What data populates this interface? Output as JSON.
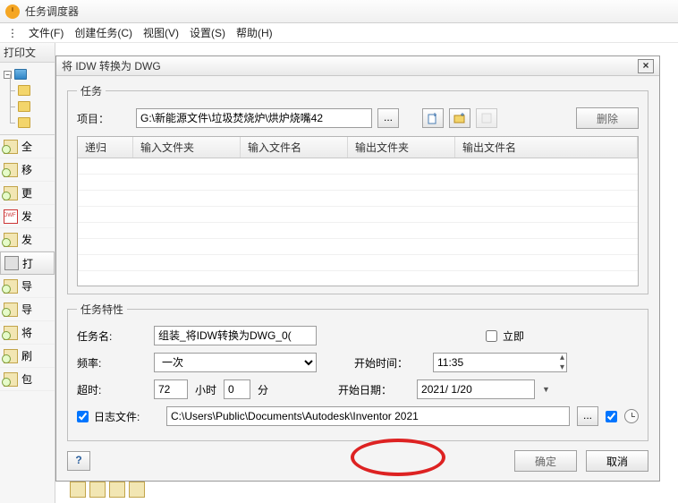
{
  "window": {
    "title": "任务调度器"
  },
  "menu": {
    "file": "文件(F)",
    "create": "创建任务(C)",
    "view": "视图(V)",
    "settings": "设置(S)",
    "help": "帮助(H)"
  },
  "left": {
    "tab": "打印文",
    "sidebar": [
      {
        "label": "全"
      },
      {
        "label": "移"
      },
      {
        "label": "更"
      },
      {
        "label": "发"
      },
      {
        "label": "发"
      },
      {
        "label": "打"
      },
      {
        "label": "导"
      },
      {
        "label": "导"
      },
      {
        "label": "将"
      },
      {
        "label": "刷"
      },
      {
        "label": "包"
      }
    ]
  },
  "dialog": {
    "title": "将 IDW 转换为 DWG",
    "task_group": "任务",
    "project_label": "项目：",
    "project_path": "G:\\新能源文件\\垃圾焚烧炉\\烘炉烧嘴42",
    "delete_btn": "删除",
    "grid_headers": {
      "recurse": "递归",
      "in_folder": "输入文件夹",
      "in_name": "输入文件名",
      "out_folder": "输出文件夹",
      "out_name": "输出文件名"
    },
    "props_group": "任务特性",
    "taskname_label": "任务名:",
    "taskname_value": "组装_将IDW转换为DWG_0(",
    "immediate_label": "立即",
    "freq_label": "频率:",
    "freq_value": "一次",
    "starttime_label": "开始时间：",
    "starttime_value": "11:35",
    "timeout_label": "超时:",
    "timeout_hours": "72",
    "timeout_h_unit": "小时",
    "timeout_mins": "0",
    "timeout_m_unit": "分",
    "startdate_label": "开始日期：",
    "startdate_value": "2021/ 1/20",
    "log_label": "日志文件:",
    "log_path": "C:\\Users\\Public\\Documents\\Autodesk\\Inventor 2021",
    "ok": "确定",
    "cancel": "取消",
    "hint": "?"
  }
}
